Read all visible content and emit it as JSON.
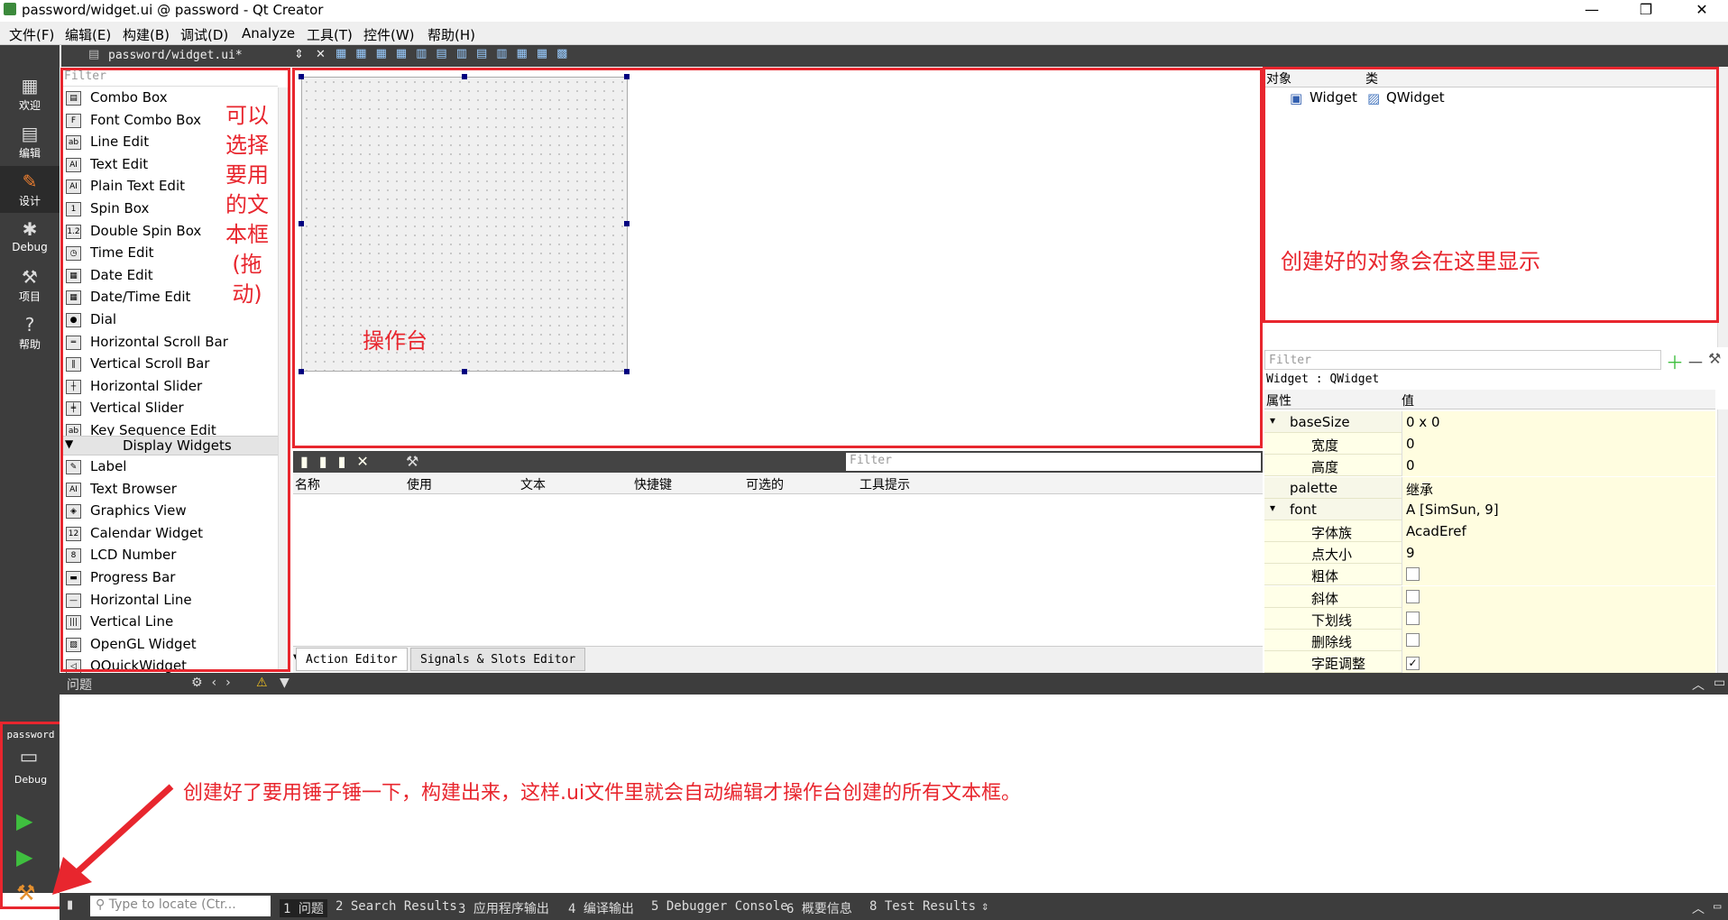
{
  "window": {
    "title": "password/widget.ui @ password - Qt Creator",
    "minimize": "—",
    "restore": "❐",
    "close": "✕"
  },
  "menubar": [
    "文件(F)",
    "编辑(E)",
    "构建(B)",
    "调试(D)",
    "Analyze",
    "工具(T)",
    "控件(W)",
    "帮助(H)"
  ],
  "modes": [
    {
      "label": "欢迎",
      "icon": "grid-icon"
    },
    {
      "label": "编辑",
      "icon": "edit-doc-icon"
    },
    {
      "label": "设计",
      "icon": "pencil-icon"
    },
    {
      "label": "Debug",
      "icon": "bug-icon"
    },
    {
      "label": "项目",
      "icon": "wrench-icon"
    },
    {
      "label": "帮助",
      "icon": "help-icon"
    }
  ],
  "run": {
    "project": "password",
    "kit": "Debug"
  },
  "doc": {
    "filename": "password/widget.ui*"
  },
  "widgetbox": {
    "filter": "Filter",
    "items": [
      "Combo Box",
      "Font Combo Box",
      "Line Edit",
      "Text Edit",
      "Plain Text Edit",
      "Spin Box",
      "Double Spin Box",
      "Time Edit",
      "Date Edit",
      "Date/Time Edit",
      "Dial",
      "Horizontal Scroll Bar",
      "Vertical Scroll Bar",
      "Horizontal Slider",
      "Vertical Slider",
      "Key Sequence Edit"
    ],
    "section": "Display Widgets",
    "display_items": [
      "Label",
      "Text Browser",
      "Graphics View",
      "Calendar Widget",
      "LCD Number",
      "Progress Bar",
      "Horizontal Line",
      "Vertical Line",
      "OpenGL Widget",
      "QQuickWidget"
    ]
  },
  "annotations": {
    "widgetbox_lines": [
      "可以",
      "选择",
      "要用",
      "的文",
      "本框",
      "(拖动)"
    ],
    "canvas": "操作台",
    "objects": "创建好的对象会在这里显示",
    "build": "创建好了要用锤子锤一下，构建出来，这样.ui文件里就会自动编辑才操作台创建的所有文本框。"
  },
  "action_editor": {
    "filter": "Filter",
    "columns": [
      "名称",
      "使用",
      "文本",
      "快捷键",
      "可选的",
      "工具提示"
    ],
    "tabs": [
      "Action Editor",
      "Signals & Slots Editor"
    ]
  },
  "object_inspector": {
    "columns": [
      "对象",
      "类"
    ],
    "row": {
      "object": "Widget",
      "class": "QWidget"
    }
  },
  "property_editor": {
    "filter": "Filter",
    "context": "Widget : QWidget",
    "columns": [
      "属性",
      "值"
    ],
    "rows": [
      {
        "name": "baseSize",
        "value": "0 x 0",
        "indent": 1,
        "expand": "▾"
      },
      {
        "name": "宽度",
        "value": "0",
        "indent": 2
      },
      {
        "name": "高度",
        "value": "0",
        "indent": 2
      },
      {
        "name": "palette",
        "value": "继承",
        "indent": 1
      },
      {
        "name": "font",
        "value": "A  [SimSun, 9]",
        "indent": 1,
        "expand": "▾"
      },
      {
        "name": "字体族",
        "value": "AcadEref",
        "indent": 2
      },
      {
        "name": "点大小",
        "value": "9",
        "indent": 2
      },
      {
        "name": "粗体",
        "check": false,
        "indent": 2
      },
      {
        "name": "斜体",
        "check": false,
        "indent": 2
      },
      {
        "name": "下划线",
        "check": false,
        "indent": 2
      },
      {
        "name": "删除线",
        "check": false,
        "indent": 2
      },
      {
        "name": "字距调整",
        "check": true,
        "indent": 2
      }
    ]
  },
  "issues": {
    "title": "问题"
  },
  "locator": {
    "placeholder": "Type to locate (Ctr..."
  },
  "output_tabs": [
    "1 问题",
    "2 Search Results",
    "3 应用程序输出",
    "4 编译输出",
    "5 Debugger Console",
    "6 概要信息",
    "8 Test Results"
  ],
  "colors": {
    "annotation": "#e8262e",
    "sidebar": "#3d3d3d",
    "property_bg": "#fffde0"
  }
}
